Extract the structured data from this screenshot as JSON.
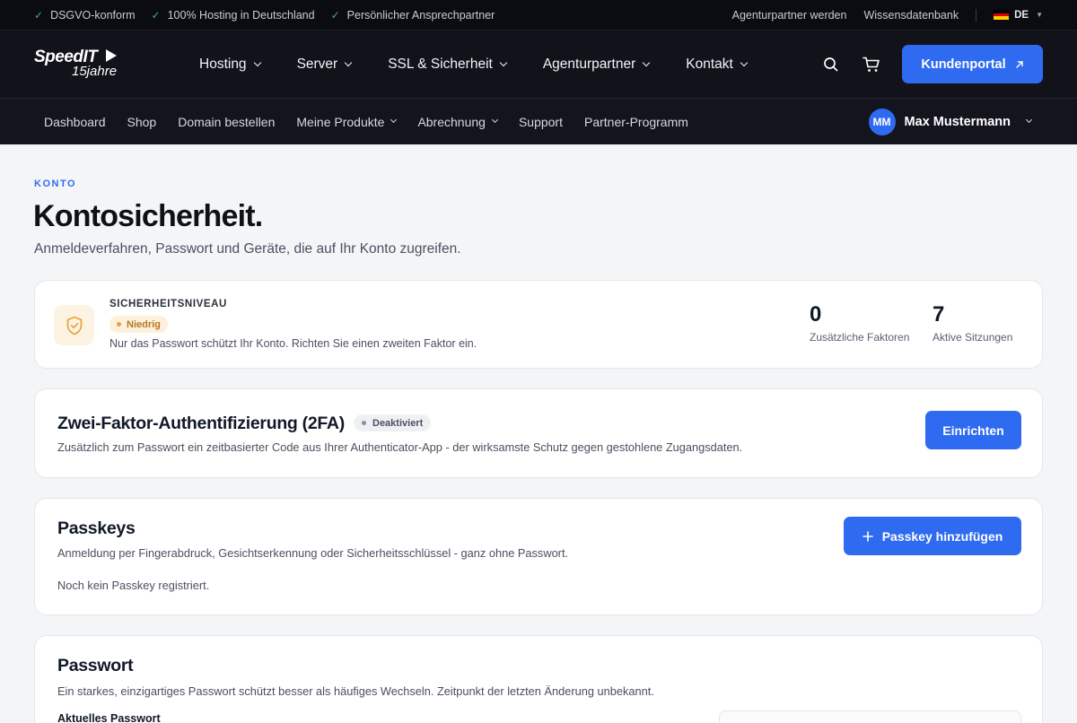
{
  "topbar": {
    "features": [
      "DSGVO-konform",
      "100% Hosting in Deutschland",
      "Persönlicher Ansprechpartner"
    ],
    "links": [
      "Agenturpartner werden",
      "Wissensdatenbank"
    ],
    "language": "DE"
  },
  "mainnav": {
    "logo_line1": "SpeedIT",
    "logo_line2": "15jahre",
    "items": [
      {
        "label": "Hosting"
      },
      {
        "label": "Server"
      },
      {
        "label": "SSL & Sicherheit"
      },
      {
        "label": "Agenturpartner"
      },
      {
        "label": "Kontakt"
      }
    ],
    "portal_button": "Kundenportal",
    "icons": [
      "search-icon",
      "cart-icon",
      "external-arrow-icon"
    ]
  },
  "subnav": {
    "items": [
      {
        "label": "Dashboard"
      },
      {
        "label": "Shop"
      },
      {
        "label": "Domain bestellen"
      },
      {
        "label": "Meine Produkte"
      },
      {
        "label": "Abrechnung"
      },
      {
        "label": "Support"
      },
      {
        "label": "Partner-Programm"
      }
    ],
    "user": {
      "initials": "MM",
      "name": "Max Mustermann"
    }
  },
  "page": {
    "eyebrow": "KONTO",
    "title": "Kontosicherheit.",
    "subtitle": "Anmeldeverfahren, Passwort und Geräte, die auf Ihr Konto zugreifen."
  },
  "security_level": {
    "label": "SICHERHEITSNIVEAU",
    "badge": "Niedrig",
    "description": "Nur das Passwort schützt Ihr Konto. Richten Sie einen zweiten Faktor ein.",
    "stats": [
      {
        "value": "0",
        "label": "Zusätzliche Faktoren"
      },
      {
        "value": "7",
        "label": "Aktive Sitzungen"
      }
    ],
    "colors": {
      "badge_bg": "#fdf0dc",
      "badge_text": "#b7791f",
      "icon": "#e8a23a"
    }
  },
  "two_factor": {
    "title": "Zwei-Faktor-Authentifizierung (2FA)",
    "status": "Deaktiviert",
    "description": "Zusätzlich zum Passwort ein zeitbasierter Code aus Ihrer Authenticator-App - der wirksamste Schutz gegen gestohlene Zugangsdaten.",
    "button": "Einrichten"
  },
  "passkeys": {
    "title": "Passkeys",
    "description": "Anmeldung per Fingerabdruck, Gesichtserkennung oder Sicherheitsschlüssel - ganz ohne Passwort.",
    "empty": "Noch kein Passkey registriert.",
    "button": "Passkey hinzufügen"
  },
  "password": {
    "title": "Passwort",
    "description": "Ein starkes, einzigartiges Passwort schützt besser als häufiges Wechseln. Zeitpunkt der letzten Änderung unbekannt.",
    "current_label": "Aktuelles Passwort"
  },
  "accent": "#2f6bf0"
}
